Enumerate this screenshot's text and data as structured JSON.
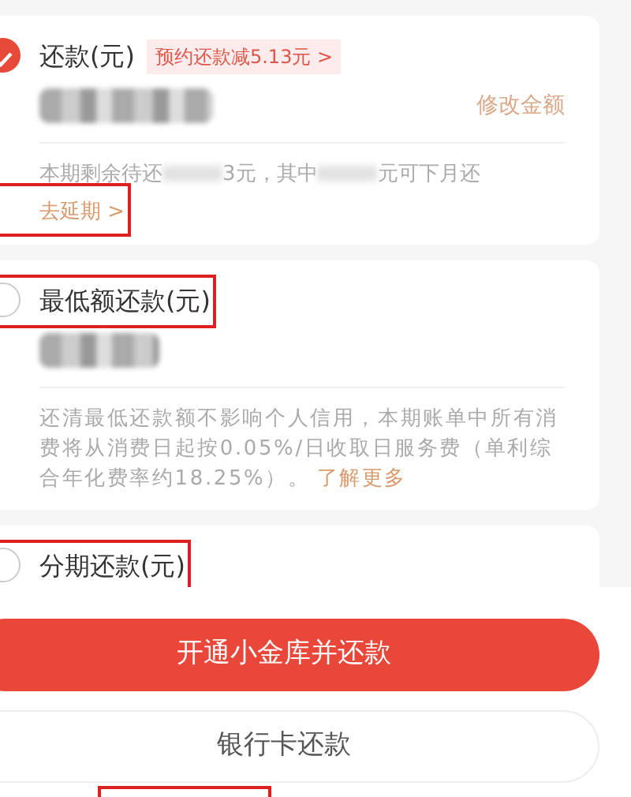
{
  "options": [
    {
      "title": "还款(元)",
      "selected": true,
      "title_marked": false,
      "promo": "预约还款减5.13元 >",
      "amount_masked": true,
      "action": "修改金额",
      "note": [
        "本期剩余待还",
        "3元，其中",
        "元可下月还"
      ],
      "link": "去延期 >",
      "link_marked": true
    },
    {
      "title": "最低额还款(元)",
      "selected": false,
      "title_marked": true,
      "amount_masked": true,
      "description": "还清最低还款额不影响个人信用，本期账单中所有消费将从消费日起按0.05%/日收取日服务费（单利综合年化费率约18.25%）。",
      "link": "了解更多"
    },
    {
      "title": "分期还款(元)",
      "selected": false,
      "title_marked": true
    }
  ],
  "buttons": [
    {
      "label": "开通小金库并还款",
      "kind": "primary"
    },
    {
      "label": "银行卡还款",
      "kind": "outline"
    }
  ],
  "footer_marked": true
}
